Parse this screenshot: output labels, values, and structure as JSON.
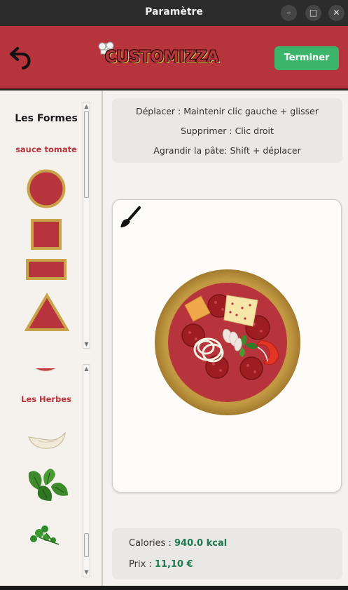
{
  "window": {
    "title": "Paramètre",
    "controls": [
      "–",
      "□",
      "✕"
    ]
  },
  "header": {
    "logo_text": "CUSTOMIZZA",
    "finish_label": "Terminer",
    "brand_color": "#b8343c",
    "accent_color": "#3bb56a"
  },
  "left_panel": {
    "shapes": {
      "title": "Les Formes",
      "subtitle": "sauce tomate",
      "items": [
        "circle-icon",
        "square-icon",
        "rectangle-icon",
        "triangle-icon"
      ]
    },
    "herbs": {
      "title": "Les Herbes",
      "items": [
        "garlic-icon",
        "basil-icon",
        "parsley-icon"
      ]
    }
  },
  "instructions": {
    "move": "Déplacer : Maintenir clic gauche + glisser",
    "delete": "Supprimer : Clic droit",
    "enlarge": "Agrandir la pâte: Shift + déplacer"
  },
  "canvas": {
    "tool_icon": "brush-icon",
    "toppings": [
      "pepperoni",
      "cheese",
      "onion",
      "pepper",
      "basil",
      "chicken"
    ]
  },
  "stats": {
    "calories_label": "Calories : ",
    "calories_value": "940.0 kcal",
    "price_label": "Prix : ",
    "price_value": "11,10 €"
  }
}
